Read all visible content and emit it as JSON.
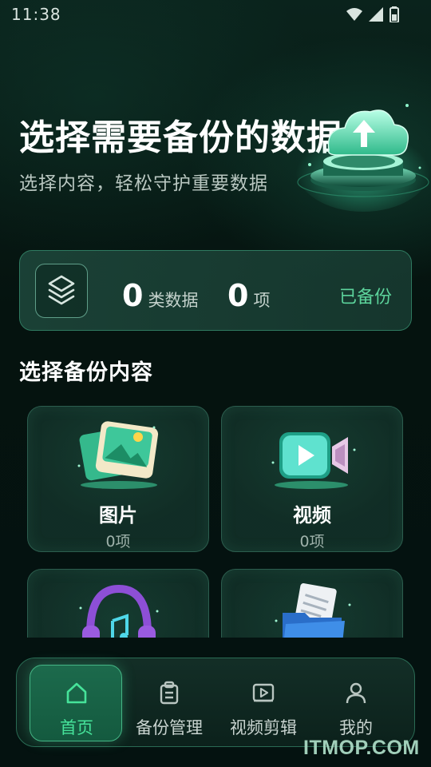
{
  "status_bar": {
    "time": "11:38"
  },
  "header": {
    "title": "选择需要备份的数据",
    "subtitle": "选择内容，轻松守护重要数据",
    "illustration_icon": "cloud-upload-icon"
  },
  "summary": {
    "categories_count": "0",
    "categories_unit": "类数据",
    "items_count": "0",
    "items_unit": "项",
    "status": "已备份",
    "icon": "layers-icon"
  },
  "section_title": "选择备份内容",
  "categories": [
    {
      "label": "图片",
      "count": "0项",
      "icon": "photo-icon"
    },
    {
      "label": "视频",
      "count": "0项",
      "icon": "video-icon"
    },
    {
      "label": "",
      "count": "",
      "icon": "music-headphones-icon"
    },
    {
      "label": "",
      "count": "",
      "icon": "folder-document-icon"
    }
  ],
  "nav": [
    {
      "label": "首页",
      "icon": "home-icon",
      "active": true
    },
    {
      "label": "备份管理",
      "icon": "clipboard-icon",
      "active": false
    },
    {
      "label": "视频剪辑",
      "icon": "video-play-icon",
      "active": false
    },
    {
      "label": "我的",
      "icon": "user-icon",
      "active": false
    }
  ],
  "watermark": "ITMOP.COM",
  "colors": {
    "accent": "#46e39a",
    "background": "#05120e",
    "card": "#1e4a3c"
  }
}
